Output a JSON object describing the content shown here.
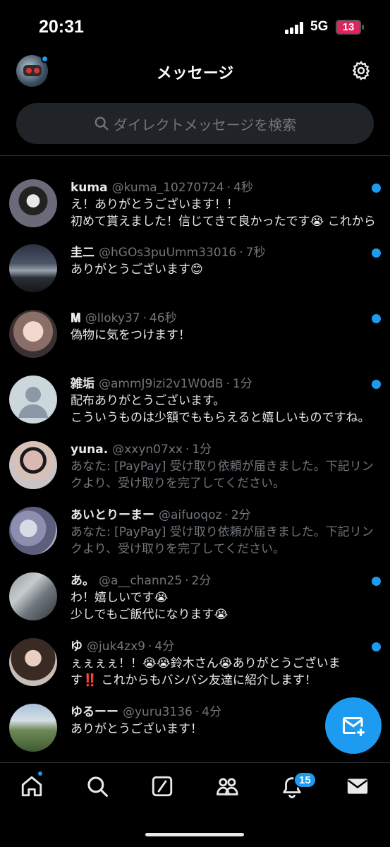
{
  "status_bar": {
    "time": "20:31",
    "network": "5G",
    "battery": "13"
  },
  "header": {
    "title": "メッセージ"
  },
  "search": {
    "placeholder": "ダイレクトメッセージを検索"
  },
  "conversations": [
    {
      "name": "kuma",
      "handle": "@kuma_10270724",
      "time": "4秒",
      "unread": true,
      "lines": [
        "え！ありがとうございます！！",
        "初めて貰えました！信じてきて良かったです😭 これから"
      ]
    },
    {
      "name": "圭二",
      "handle": "@hGOs3puUmm33016",
      "time": "7秒",
      "unread": true,
      "lines": [
        "ありがとうございます😊"
      ]
    },
    {
      "name": "𝐌",
      "handle": "@lloky37",
      "time": "46秒",
      "unread": true,
      "lines": [
        "偽物に気をつけます！"
      ]
    },
    {
      "name": "雑垢",
      "handle": "@ammJ9izi2v1W0dB",
      "time": "1分",
      "unread": true,
      "lines": [
        "配布ありがとうございます。",
        "こういうものは少額でももらえると嬉しいものですね。"
      ]
    },
    {
      "name": "yuna.",
      "handle": "@xxyn07xx",
      "time": "1分",
      "unread": false,
      "lines": [
        "あなた: [PayPay] 受け取り依頼が届きました。下記リン",
        "クより、受け取りを完了してください。"
      ]
    },
    {
      "name": "あいとりーまー",
      "handle": "@aifuoqoz",
      "time": "2分",
      "unread": false,
      "lines": [
        "あなた: [PayPay] 受け取り依頼が届きました。下記リン",
        "クより、受け取りを完了してください。"
      ]
    },
    {
      "name": "あ。",
      "handle": "@a__chann25",
      "time": "2分",
      "unread": true,
      "lines": [
        "わ！嬉しいです😭",
        "少しでもご飯代になります😭"
      ]
    },
    {
      "name": "ゆ",
      "handle": "@juk4zx9",
      "time": "4分",
      "unread": true,
      "lines": [
        "ぇぇぇぇ！！😭😭鈴木さん😭ありがとうございま",
        "す‼️ これからもバシバシ友達に紹介します！"
      ]
    },
    {
      "name": "ゆるーー",
      "handle": "@yuru3136",
      "time": "4分",
      "unread": false,
      "lines": [
        "ありがとうございます！"
      ]
    }
  ],
  "nav": {
    "notifications_badge": "15"
  },
  "colors": {
    "accent": "#1d9bf0",
    "background": "#000000",
    "muted": "#71767b"
  }
}
